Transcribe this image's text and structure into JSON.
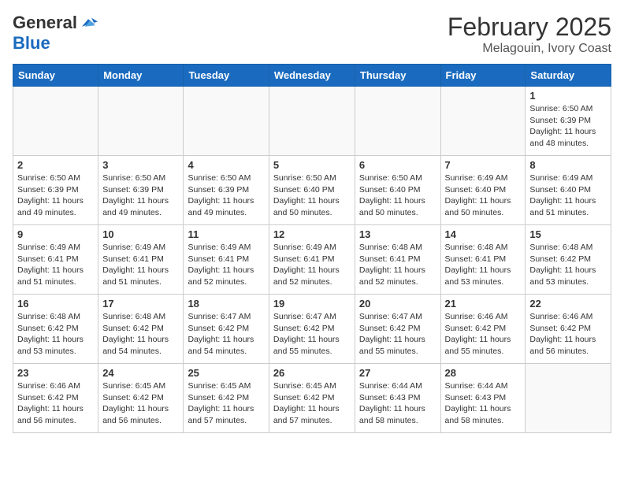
{
  "header": {
    "logo_general": "General",
    "logo_blue": "Blue",
    "month_title": "February 2025",
    "location": "Melagouin, Ivory Coast"
  },
  "days_of_week": [
    "Sunday",
    "Monday",
    "Tuesday",
    "Wednesday",
    "Thursday",
    "Friday",
    "Saturday"
  ],
  "weeks": [
    [
      {
        "day": "",
        "info": ""
      },
      {
        "day": "",
        "info": ""
      },
      {
        "day": "",
        "info": ""
      },
      {
        "day": "",
        "info": ""
      },
      {
        "day": "",
        "info": ""
      },
      {
        "day": "",
        "info": ""
      },
      {
        "day": "1",
        "info": "Sunrise: 6:50 AM\nSunset: 6:39 PM\nDaylight: 11 hours and 48 minutes."
      }
    ],
    [
      {
        "day": "2",
        "info": "Sunrise: 6:50 AM\nSunset: 6:39 PM\nDaylight: 11 hours and 49 minutes."
      },
      {
        "day": "3",
        "info": "Sunrise: 6:50 AM\nSunset: 6:39 PM\nDaylight: 11 hours and 49 minutes."
      },
      {
        "day": "4",
        "info": "Sunrise: 6:50 AM\nSunset: 6:39 PM\nDaylight: 11 hours and 49 minutes."
      },
      {
        "day": "5",
        "info": "Sunrise: 6:50 AM\nSunset: 6:40 PM\nDaylight: 11 hours and 50 minutes."
      },
      {
        "day": "6",
        "info": "Sunrise: 6:50 AM\nSunset: 6:40 PM\nDaylight: 11 hours and 50 minutes."
      },
      {
        "day": "7",
        "info": "Sunrise: 6:49 AM\nSunset: 6:40 PM\nDaylight: 11 hours and 50 minutes."
      },
      {
        "day": "8",
        "info": "Sunrise: 6:49 AM\nSunset: 6:40 PM\nDaylight: 11 hours and 51 minutes."
      }
    ],
    [
      {
        "day": "9",
        "info": "Sunrise: 6:49 AM\nSunset: 6:41 PM\nDaylight: 11 hours and 51 minutes."
      },
      {
        "day": "10",
        "info": "Sunrise: 6:49 AM\nSunset: 6:41 PM\nDaylight: 11 hours and 51 minutes."
      },
      {
        "day": "11",
        "info": "Sunrise: 6:49 AM\nSunset: 6:41 PM\nDaylight: 11 hours and 52 minutes."
      },
      {
        "day": "12",
        "info": "Sunrise: 6:49 AM\nSunset: 6:41 PM\nDaylight: 11 hours and 52 minutes."
      },
      {
        "day": "13",
        "info": "Sunrise: 6:48 AM\nSunset: 6:41 PM\nDaylight: 11 hours and 52 minutes."
      },
      {
        "day": "14",
        "info": "Sunrise: 6:48 AM\nSunset: 6:41 PM\nDaylight: 11 hours and 53 minutes."
      },
      {
        "day": "15",
        "info": "Sunrise: 6:48 AM\nSunset: 6:42 PM\nDaylight: 11 hours and 53 minutes."
      }
    ],
    [
      {
        "day": "16",
        "info": "Sunrise: 6:48 AM\nSunset: 6:42 PM\nDaylight: 11 hours and 53 minutes."
      },
      {
        "day": "17",
        "info": "Sunrise: 6:48 AM\nSunset: 6:42 PM\nDaylight: 11 hours and 54 minutes."
      },
      {
        "day": "18",
        "info": "Sunrise: 6:47 AM\nSunset: 6:42 PM\nDaylight: 11 hours and 54 minutes."
      },
      {
        "day": "19",
        "info": "Sunrise: 6:47 AM\nSunset: 6:42 PM\nDaylight: 11 hours and 55 minutes."
      },
      {
        "day": "20",
        "info": "Sunrise: 6:47 AM\nSunset: 6:42 PM\nDaylight: 11 hours and 55 minutes."
      },
      {
        "day": "21",
        "info": "Sunrise: 6:46 AM\nSunset: 6:42 PM\nDaylight: 11 hours and 55 minutes."
      },
      {
        "day": "22",
        "info": "Sunrise: 6:46 AM\nSunset: 6:42 PM\nDaylight: 11 hours and 56 minutes."
      }
    ],
    [
      {
        "day": "23",
        "info": "Sunrise: 6:46 AM\nSunset: 6:42 PM\nDaylight: 11 hours and 56 minutes."
      },
      {
        "day": "24",
        "info": "Sunrise: 6:45 AM\nSunset: 6:42 PM\nDaylight: 11 hours and 56 minutes."
      },
      {
        "day": "25",
        "info": "Sunrise: 6:45 AM\nSunset: 6:42 PM\nDaylight: 11 hours and 57 minutes."
      },
      {
        "day": "26",
        "info": "Sunrise: 6:45 AM\nSunset: 6:42 PM\nDaylight: 11 hours and 57 minutes."
      },
      {
        "day": "27",
        "info": "Sunrise: 6:44 AM\nSunset: 6:43 PM\nDaylight: 11 hours and 58 minutes."
      },
      {
        "day": "28",
        "info": "Sunrise: 6:44 AM\nSunset: 6:43 PM\nDaylight: 11 hours and 58 minutes."
      },
      {
        "day": "",
        "info": ""
      }
    ]
  ]
}
